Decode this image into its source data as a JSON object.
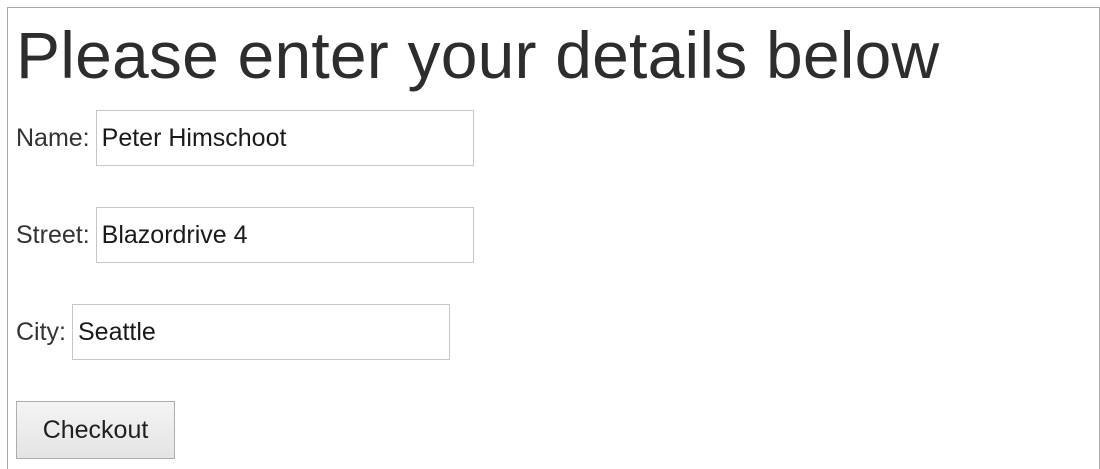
{
  "page": {
    "title": "Please enter your details below"
  },
  "form": {
    "name": {
      "label": "Name:",
      "value": "Peter Himschoot"
    },
    "street": {
      "label": "Street:",
      "value": "Blazordrive 4"
    },
    "city": {
      "label": "City:",
      "value": "Seattle"
    },
    "checkout_label": "Checkout"
  }
}
